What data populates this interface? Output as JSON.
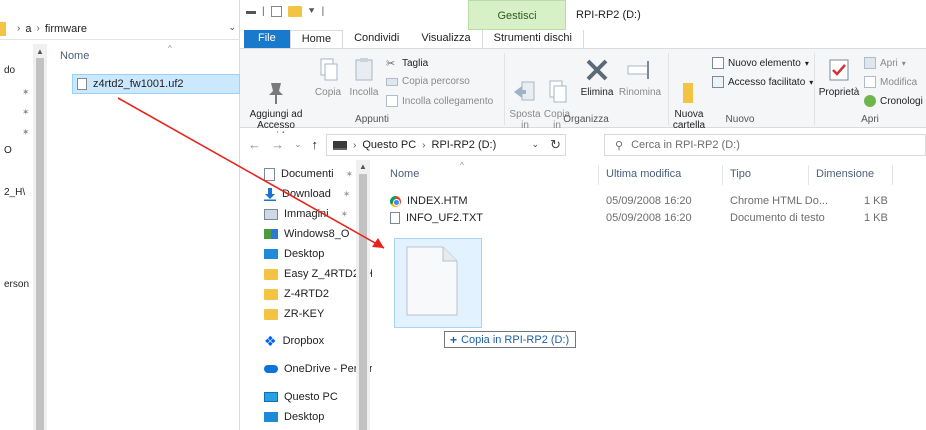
{
  "left_window": {
    "breadcrumb": [
      "a",
      "firmware"
    ],
    "column_name": "Nome",
    "selected_file": "z4rtd2_fw1001.uf2",
    "nav_fragments": [
      "do",
      "O",
      "2_H\\",
      "erson"
    ]
  },
  "title_bar": {
    "contextual_tab_group": "Gestisci",
    "window_title": "RPI-RP2 (D:)"
  },
  "tabs": {
    "file": "File",
    "home": "Home",
    "share": "Condividi",
    "view": "Visualizza",
    "drive_tools": "Strumenti dischi"
  },
  "ribbon": {
    "clipboard": {
      "label": "Appunti",
      "pin": "Aggiungi ad\nAccesso rapido",
      "copy": "Copia",
      "paste": "Incolla",
      "cut": "Taglia",
      "copy_path": "Copia percorso",
      "paste_shortcut": "Incolla collegamento"
    },
    "organize": {
      "label": "Organizza",
      "move_to": "Sposta\nin",
      "copy_to": "Copia\nin",
      "delete": "Elimina",
      "rename": "Rinomina"
    },
    "new": {
      "label": "Nuovo",
      "new_folder": "Nuova\ncartella",
      "new_item": "Nuovo elemento",
      "easy_access": "Accesso facilitato"
    },
    "open": {
      "label": "Apri",
      "properties": "Proprietà",
      "open": "Apri",
      "edit": "Modifica",
      "history": "Cronologi"
    }
  },
  "address": {
    "segments": [
      "Questo PC",
      "RPI-RP2 (D:)"
    ],
    "search_placeholder": "Cerca in RPI-RP2 (D:)"
  },
  "nav_pane": {
    "items": [
      {
        "label": "Documenti",
        "icon": "document-icon",
        "pinned": true
      },
      {
        "label": "Download",
        "icon": "download-icon",
        "pinned": true
      },
      {
        "label": "Immagini",
        "icon": "pictures-icon",
        "pinned": true
      },
      {
        "label": "Windows8_O",
        "icon": "windows-drive-icon",
        "pinned": true
      },
      {
        "label": "Desktop",
        "icon": "desktop-icon",
        "pinned": false
      },
      {
        "label": "Easy Z_4RTD2_H\\",
        "icon": "folder-icon",
        "pinned": false
      },
      {
        "label": "Z-4RTD2",
        "icon": "folder-icon",
        "pinned": false
      },
      {
        "label": "ZR-KEY",
        "icon": "folder-icon",
        "pinned": false
      },
      {
        "label": "Dropbox",
        "icon": "dropbox-icon",
        "pinned": false
      },
      {
        "label": "OneDrive - Persor",
        "icon": "onedrive-icon",
        "pinned": false
      },
      {
        "label": "Questo PC",
        "icon": "this-pc-icon",
        "pinned": false
      },
      {
        "label": "Desktop",
        "icon": "desktop-icon",
        "pinned": false
      }
    ]
  },
  "file_list": {
    "columns": {
      "name": "Nome",
      "modified": "Ultima modifica",
      "type": "Tipo",
      "size": "Dimensione"
    },
    "rows": [
      {
        "name": "INDEX.HTM",
        "modified": "05/09/2008 16:20",
        "type": "Chrome HTML Do...",
        "size": "1 KB",
        "icon": "chrome-icon"
      },
      {
        "name": "INFO_UF2.TXT",
        "modified": "05/09/2008 16:20",
        "type": "Documento di testo",
        "size": "1 KB",
        "icon": "text-file-icon"
      }
    ]
  },
  "drag": {
    "tooltip": "Copia in RPI-RP2 (D:)",
    "plus": "+",
    "arrow_color": "#e8231b"
  }
}
